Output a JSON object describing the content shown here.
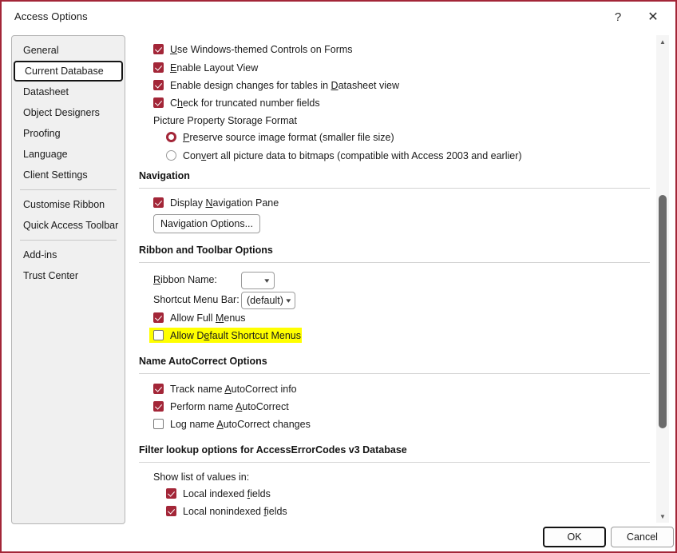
{
  "window": {
    "title": "Access Options",
    "help_icon": "?",
    "close_icon": "✕",
    "border_color": "#a32638",
    "accent_color": "#a32638",
    "highlight_color": "#ffff00"
  },
  "sidebar": {
    "items": [
      {
        "label": "General",
        "selected": false
      },
      {
        "label": "Current Database",
        "selected": true
      },
      {
        "label": "Datasheet",
        "selected": false
      },
      {
        "label": "Object Designers",
        "selected": false
      },
      {
        "label": "Proofing",
        "selected": false
      },
      {
        "label": "Language",
        "selected": false
      },
      {
        "label": "Client Settings",
        "selected": false
      },
      {
        "label": "Customise Ribbon",
        "selected": false
      },
      {
        "label": "Quick Access Toolbar",
        "selected": false
      },
      {
        "label": "Add-ins",
        "selected": false
      },
      {
        "label": "Trust Center",
        "selected": false
      }
    ]
  },
  "content": {
    "app_options": {
      "checkboxes": [
        {
          "label": "Use Windows-themed Controls on Forms",
          "accel": "U",
          "checked": true
        },
        {
          "label": "Enable Layout View",
          "accel": "E",
          "checked": true
        },
        {
          "label": "Enable design changes for tables in Datasheet view",
          "accel": "D",
          "checked": true
        },
        {
          "label": "Check for truncated number fields",
          "accel": "h",
          "checked": true
        }
      ],
      "picture_format_label": "Picture Property Storage Format",
      "radios": [
        {
          "label": "Preserve source image format (smaller file size)",
          "accel": "P",
          "selected": true
        },
        {
          "label": "Convert all picture data to bitmaps (compatible with Access 2003 and earlier)",
          "accel": "v",
          "selected": false
        }
      ]
    },
    "navigation": {
      "heading": "Navigation",
      "display_pane": {
        "label": "Display Navigation Pane",
        "accel": "N",
        "checked": true
      },
      "options_button": "Navigation Options..."
    },
    "ribbon": {
      "heading": "Ribbon and Toolbar Options",
      "ribbon_name_label": "Ribbon Name:",
      "ribbon_name_accel": "R",
      "ribbon_name_value": "",
      "shortcut_menu_label": "Shortcut Menu Bar:",
      "shortcut_menu_value": "(default)",
      "allow_full_menus": {
        "label": "Allow Full Menus",
        "accel": "M",
        "checked": true
      },
      "allow_default_shortcut_menus": {
        "label": "Allow Default Shortcut Menus",
        "accel": "e",
        "checked": false,
        "highlighted": true
      }
    },
    "autocorrect": {
      "heading": "Name AutoCorrect Options",
      "checkboxes": [
        {
          "label": "Track name AutoCorrect info",
          "accel": "A",
          "checked": true
        },
        {
          "label": "Perform name AutoCorrect",
          "accel": "A",
          "checked": true
        },
        {
          "label": "Log name AutoCorrect changes",
          "accel": "A",
          "checked": false
        }
      ]
    },
    "filter_lookup": {
      "heading": "Filter lookup options for AccessErrorCodes v3 Database",
      "show_list_label": "Show list of values in:",
      "checkboxes": [
        {
          "label": "Local indexed fields",
          "accel": "f",
          "checked": true
        },
        {
          "label": "Local nonindexed fields",
          "accel": "f",
          "checked": true
        }
      ]
    }
  },
  "scrollbar": {
    "up_arrow": "▲",
    "down_arrow": "▼"
  },
  "footer": {
    "ok_label": "OK",
    "cancel_label": "Cancel"
  }
}
